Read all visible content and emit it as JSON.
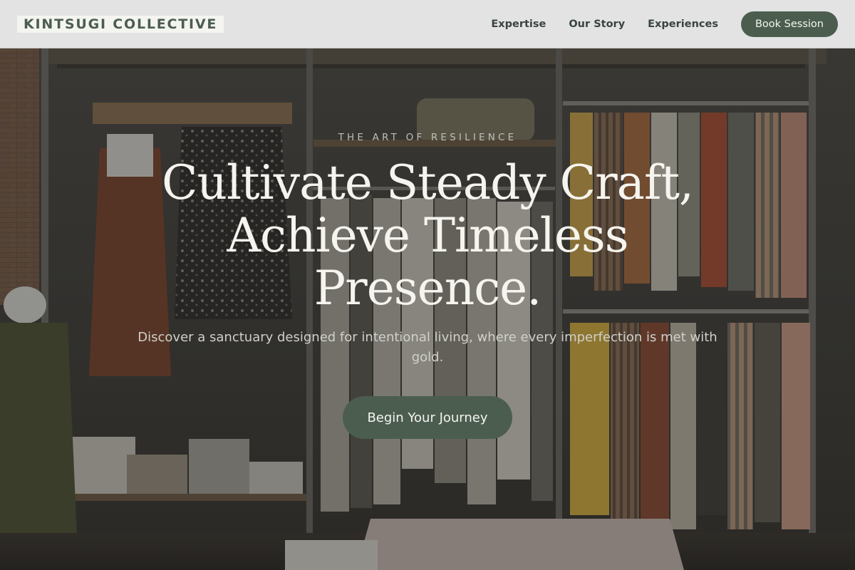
{
  "header": {
    "brand": "KINTSUGI COLLECTIVE",
    "nav": [
      {
        "label": "Expertise"
      },
      {
        "label": "Our Story"
      },
      {
        "label": "Experiences"
      }
    ],
    "cta_label": "Book Session"
  },
  "hero": {
    "eyebrow": "THE ART OF RESILIENCE",
    "headline_line1": "Cultivate Steady Craft,",
    "headline_line2": "Achieve Timeless",
    "headline_line3": "Presence.",
    "subtext": "Discover a sanctuary designed for intentional living, where every imperfection is met with gold.",
    "cta_label": "Begin Your Journey"
  },
  "colors": {
    "accent": "#4b5d4f",
    "nav_bg": "#e2e3e2",
    "brand_bg": "#f4f4f0",
    "headline": "#f6f4ee"
  }
}
